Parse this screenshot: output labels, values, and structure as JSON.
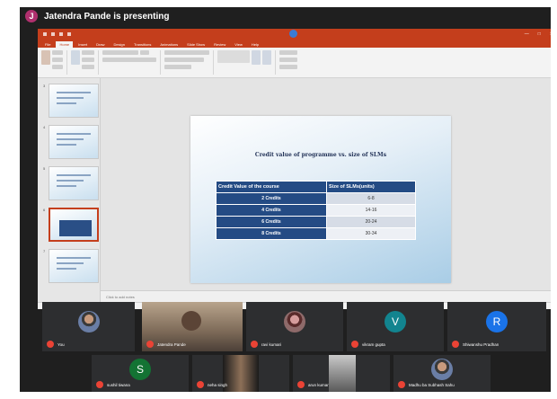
{
  "meeting": {
    "presenter_initial": "J",
    "presenter_banner": "Jatendra Pande is presenting"
  },
  "ppt": {
    "tabs": [
      "File",
      "Home",
      "Insert",
      "Draw",
      "Design",
      "Transitions",
      "Animations",
      "Slide Show",
      "Review",
      "View",
      "Help"
    ],
    "active_tab": "Home",
    "thumbnail_numbers": [
      "3",
      "4",
      "5",
      "6",
      "7"
    ],
    "notes_placeholder": "Click to add notes"
  },
  "slide": {
    "title": "Credit value of programme vs. size of SLMs",
    "table": {
      "headers": [
        "Credit Value of the course",
        "Size of SLMs(units)"
      ],
      "rows": [
        [
          "2 Credits",
          "6-8"
        ],
        [
          "4 Credits",
          "14-16"
        ],
        [
          "6 Credits",
          "20-24"
        ],
        [
          "8 Credits",
          "30-34"
        ]
      ]
    }
  },
  "participants": [
    {
      "name": "You",
      "avatar": "photo"
    },
    {
      "name": "Jatendra Pande",
      "avatar": "video"
    },
    {
      "name": "ravi kumari",
      "avatar": "photo"
    },
    {
      "name": "vikram gupta",
      "avatar": "letter",
      "initial": "V",
      "color": "#12848f"
    },
    {
      "name": "Shiwanshu Pradhan",
      "avatar": "letter",
      "initial": "R",
      "color": "#1a73e8"
    },
    {
      "name": "sushil tiwana",
      "avatar": "letter",
      "initial": "S",
      "color": "#137333"
    },
    {
      "name": "neha singh",
      "avatar": "video"
    },
    {
      "name": "arun kumar",
      "avatar": "video"
    },
    {
      "name": "Madhu ba Subhash Sahu",
      "avatar": "photo"
    }
  ],
  "colors": {
    "ppt_accent": "#c43e1c",
    "table_header": "#244b84",
    "mic_muted": "#ea4335",
    "tile_bg": "#2d2e30"
  }
}
